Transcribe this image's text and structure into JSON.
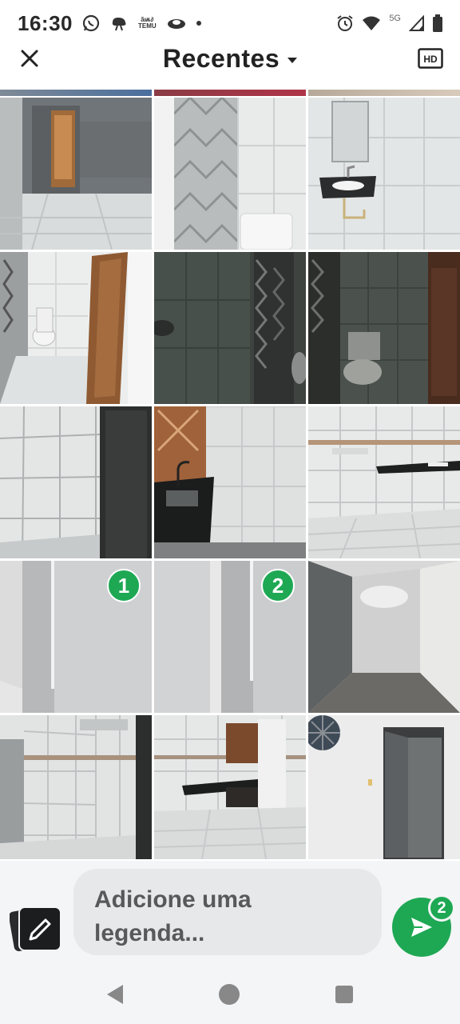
{
  "status_bar": {
    "time": "16:30",
    "temu_top": "ãѭ∂",
    "temu_bottom": "TEMU",
    "network": "5G",
    "icons": [
      "whatsapp-icon",
      "cloud-app-icon",
      "temu-icon",
      "notification-icon",
      "alarm-icon",
      "wifi-icon",
      "signal-icon",
      "battery-icon"
    ]
  },
  "header": {
    "title": "Recentes",
    "hd_label": "HD",
    "close_icon": "close-icon",
    "dropdown_icon": "chevron-down-icon"
  },
  "gallery": {
    "selected": [
      {
        "tile": 10,
        "order": "1"
      },
      {
        "tile": 11,
        "order": "2"
      }
    ],
    "tiles": [
      "hallway-doorway-photo",
      "shower-tiles-toilet-photo",
      "sink-mirror-photo",
      "toilet-door-photo",
      "dark-bathroom-photo",
      "dark-toilet-photo",
      "tiled-wall-door-photo",
      "kitchen-sink-photo",
      "tiled-countertop-photo",
      "white-wall-photo-1",
      "white-wall-photo-2",
      "corner-room-photo",
      "tiled-room-photo",
      "kitchen-counter-photo",
      "room-dark-door-photo"
    ]
  },
  "compose": {
    "placeholder": "Adicione uma legenda...",
    "send_count": "2",
    "edit_icon": "pencil-icon",
    "send_icon": "send-icon"
  },
  "nav": {
    "icons": [
      "back-icon",
      "home-icon",
      "recents-icon"
    ]
  },
  "colors": {
    "accent": "#1ea854",
    "bottom_bg": "#f4f5f6",
    "caption_bg": "#e6e8ea"
  }
}
